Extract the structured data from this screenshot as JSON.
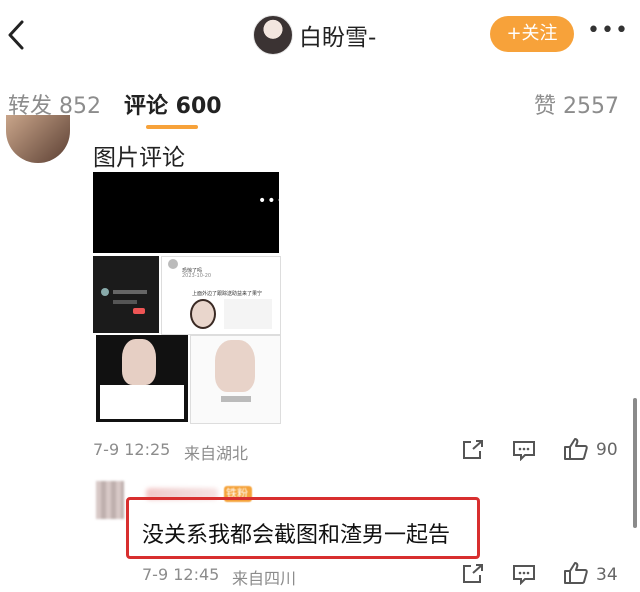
{
  "header": {
    "username": "白盼雪-",
    "follow_label": "+关注",
    "more_label": "•••"
  },
  "tabs": [
    {
      "label": "转发 852"
    },
    {
      "label": "评论 600"
    },
    {
      "label": "赞 2557"
    }
  ],
  "comment1": {
    "text": "图片评论",
    "time": "7-9 12:25",
    "location": "来自湖北",
    "like_count": "90",
    "images": {
      "t2_time": "2023-10-20",
      "t2_line1": "恐惊了吗",
      "t2_line2": "上面外边了跟踪送助益来了果宁"
    }
  },
  "comment2": {
    "badge": "铁粉",
    "text": "没关系我都会截图和渣男一起告",
    "time": "7-9 12:45",
    "location": "来自四川",
    "like_count": "34"
  },
  "colors": {
    "accent": "#f7a23a",
    "highlight": "#d82f2f"
  }
}
